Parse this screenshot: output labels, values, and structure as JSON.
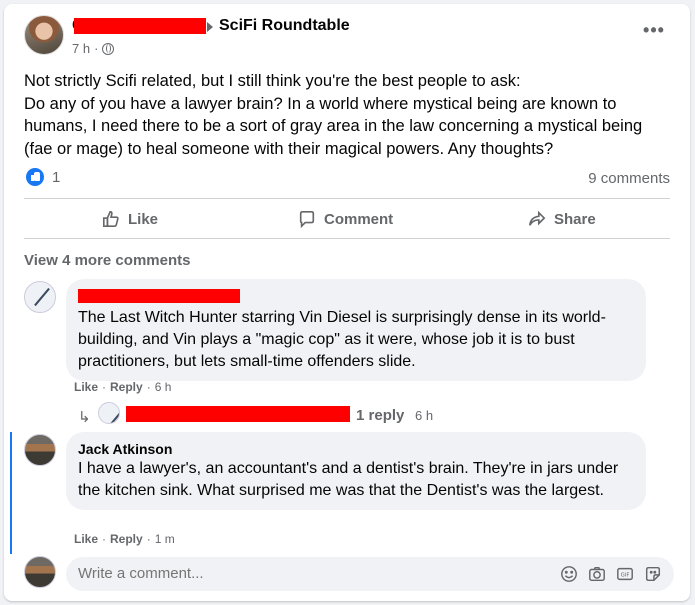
{
  "post": {
    "author_initial": "C",
    "group": "SciFi Roundtable",
    "time": "7 h",
    "text_lines": [
      "Not strictly Scifi related, but I still think you're the best people to ask:",
      "Do any of you have a lawyer brain? In a world where mystical being are known to humans, I need there to be a sort of gray area in the law concerning a mystical being (fae or mage) to heal someone with their magical powers. Any thoughts?"
    ],
    "reactions_count": "1",
    "comments_count": "9 comments"
  },
  "actions": {
    "like": "Like",
    "comment": "Comment",
    "share": "Share"
  },
  "view_more": "View 4 more comments",
  "comments": [
    {
      "text": "The Last Witch Hunter starring Vin Diesel is surprisingly dense in its world-building, and Vin plays a \"magic cop\" as it were, whose job it is to bust practitioners, but lets small-time offenders slide.",
      "like": "Like",
      "reply": "Reply",
      "time": "6 h",
      "replies_label": "1 reply",
      "replies_time": "6 h"
    },
    {
      "author": "Jack Atkinson",
      "text": "I have a lawyer's, an accountant's and a dentist's brain. They're in jars under the kitchen sink. What surprised me was that the Dentist's was the largest.",
      "like": "Like",
      "reply": "Reply",
      "time": "1 m"
    }
  ],
  "composer": {
    "placeholder": "Write a comment..."
  },
  "icons": {
    "more": "more-options-icon",
    "globe": "globe-icon",
    "emoji": "emoji-icon",
    "camera": "camera-icon",
    "gif": "gif-icon",
    "sticker": "sticker-icon"
  },
  "colors": {
    "accent": "#1877f2",
    "redaction": "#ff0000",
    "secondary_text": "#65676b"
  }
}
